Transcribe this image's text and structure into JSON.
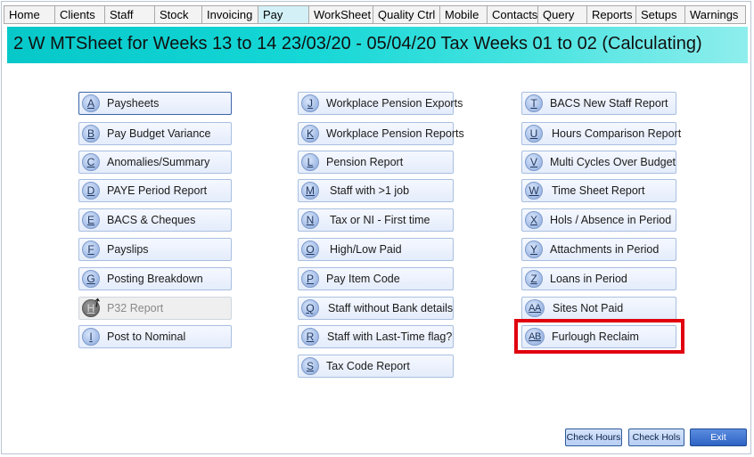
{
  "tabs": [
    "Home",
    "Clients",
    "Staff",
    "Stock",
    "Invoicing",
    "Pay",
    "WorkSheet",
    "Quality Ctrl",
    "Mobile",
    "Contacts",
    "Query",
    "Reports",
    "Setups",
    "Warnings"
  ],
  "active_tab": "Pay",
  "title": "2 W MTSheet for Weeks 13 to 14 23/03/20 - 05/04/20 Tax Weeks 01 to 02  (Calculating)",
  "columns": [
    [
      {
        "key": "A",
        "label": "Paysheets"
      },
      {
        "key": "B",
        "label": "Pay Budget Variance"
      },
      {
        "key": "C",
        "label": "Anomalies/Summary"
      },
      {
        "key": "D",
        "label": "PAYE Period Report"
      },
      {
        "key": "E",
        "label": "BACS & Cheques"
      },
      {
        "key": "F",
        "label": "Payslips"
      },
      {
        "key": "G",
        "label": "Posting Breakdown"
      },
      {
        "key": "H",
        "label": "P32 Report"
      },
      {
        "key": "I",
        "label": "Post to Nominal"
      }
    ],
    [
      {
        "key": "J",
        "label": "Workplace Pension Exports"
      },
      {
        "key": "K",
        "label": "Workplace Pension Reports"
      },
      {
        "key": "L",
        "label": "Pension Report"
      },
      {
        "key": "M",
        "label": "Staff with >1 job"
      },
      {
        "key": "N",
        "label": "Tax or NI - First time"
      },
      {
        "key": "O",
        "label": "High/Low Paid"
      },
      {
        "key": "P",
        "label": "Pay Item Code"
      },
      {
        "key": "Q",
        "label": "Staff without Bank details"
      },
      {
        "key": "R",
        "label": "Staff with Last-Time flag?"
      },
      {
        "key": "S",
        "label": "Tax Code Report"
      }
    ],
    [
      {
        "key": "T",
        "label": "BACS New Staff Report"
      },
      {
        "key": "U",
        "label": "Hours Comparison Report"
      },
      {
        "key": "V",
        "label": "Multi Cycles Over Budget"
      },
      {
        "key": "W",
        "label": "Time Sheet Report"
      },
      {
        "key": "X",
        "label": "Hols / Absence in Period"
      },
      {
        "key": "Y",
        "label": "Attachments in Period"
      },
      {
        "key": "Z",
        "label": "Loans in Period"
      },
      {
        "key": "AA",
        "label": "Sites Not Paid"
      },
      {
        "key": "AB",
        "label": "Furlough Reclaim"
      }
    ]
  ],
  "bottom_buttons": {
    "check_hours": "Check Hours",
    "check_hols": "Check Hols",
    "exit": "Exit"
  }
}
